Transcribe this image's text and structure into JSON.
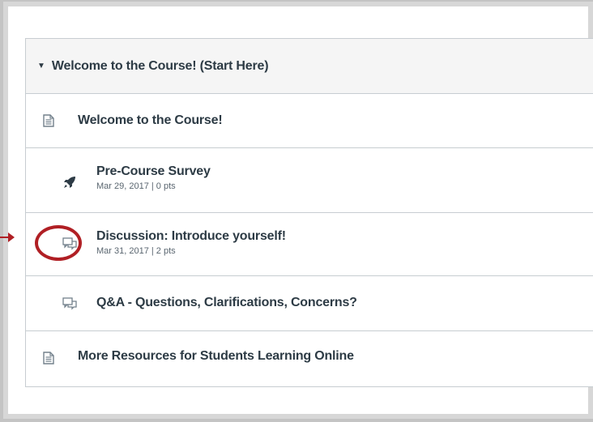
{
  "module": {
    "title": "Welcome to the Course! (Start Here)",
    "caret_icon": "caret-down-icon",
    "expanded": true
  },
  "items": [
    {
      "icon": "page-icon",
      "title": "Welcome to the Course!",
      "meta": ""
    },
    {
      "icon": "quiz-rocket-icon",
      "title": "Pre-Course Survey",
      "meta": "Mar 29, 2017 | 0 pts"
    },
    {
      "icon": "discussion-icon",
      "title": "Discussion: Introduce yourself!",
      "meta": "Mar 31, 2017 | 2 pts",
      "highlighted": true
    },
    {
      "icon": "discussion-icon",
      "title": "Q&A - Questions, Clarifications, Concerns?",
      "meta": ""
    },
    {
      "icon": "page-icon",
      "title": "More Resources for Students Learning Online",
      "meta": ""
    }
  ],
  "colors": {
    "annotation_red": "#b01f24",
    "text": "#2d3b45",
    "border": "#c7cdd1",
    "header_bg": "#f5f5f5",
    "icon": "#73818c"
  }
}
